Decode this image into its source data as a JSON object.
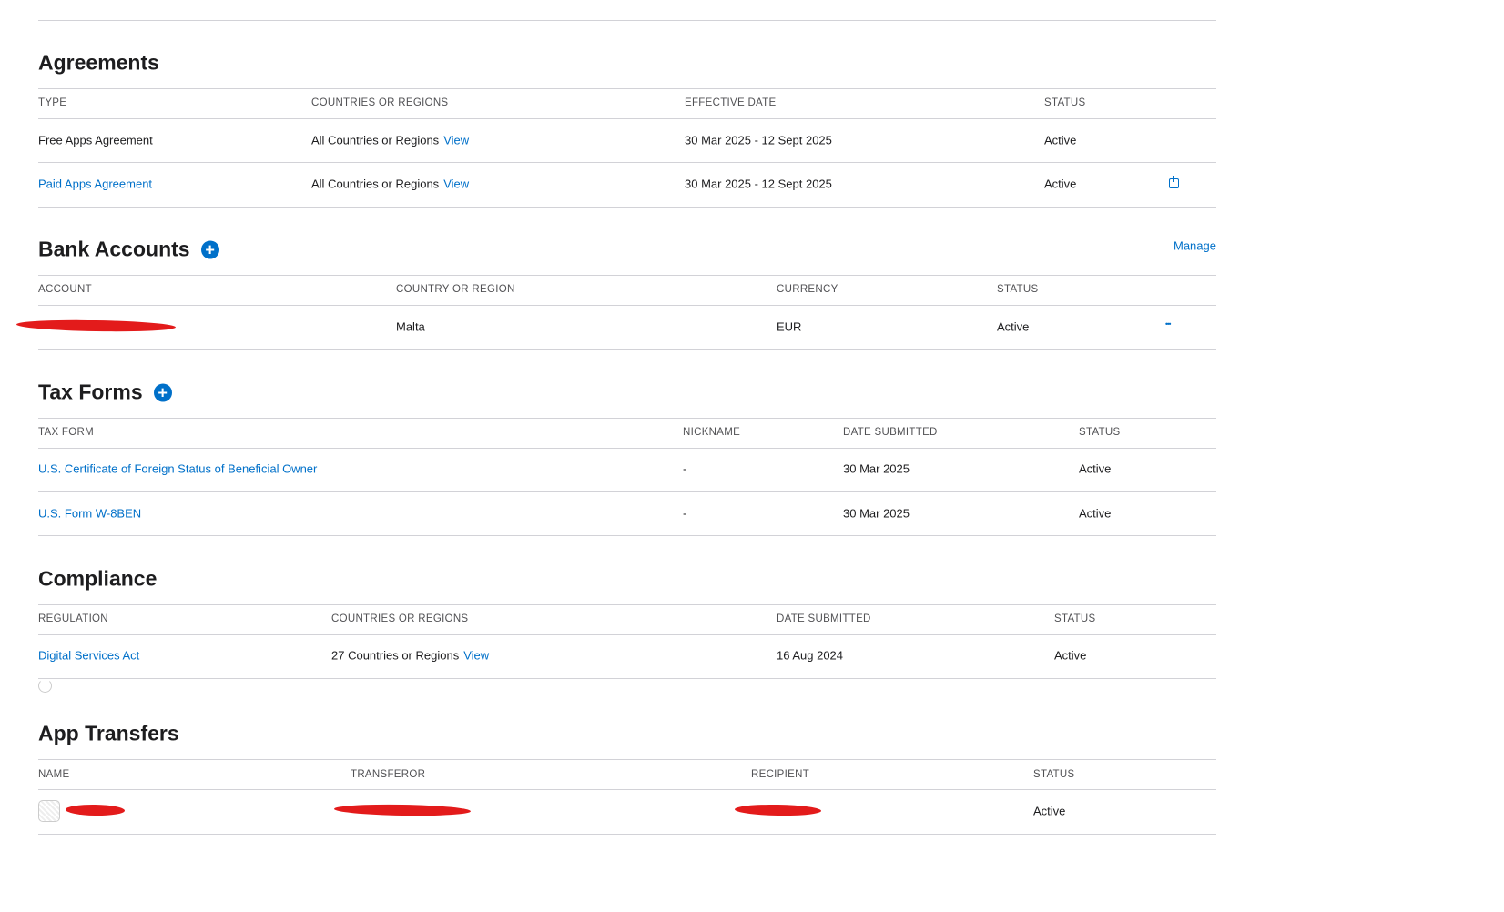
{
  "sections": [
    {
      "id": "agreements",
      "title": "Agreements",
      "add": false,
      "headers": [
        "TYPE",
        "COUNTRIES OR REGIONS",
        "EFFECTIVE DATE",
        "STATUS"
      ],
      "rows": [
        [
          {
            "t": "Free Apps Agreement"
          },
          {
            "t": "All Countries or Regions",
            "link": "View"
          },
          {
            "t": "30 Mar 2025 - 12 Sept 2025"
          },
          {
            "t": "Active"
          }
        ],
        [
          {
            "t": "Paid Apps Agreement",
            "isLink": true
          },
          {
            "t": "All Countries or Regions",
            "link": "View"
          },
          {
            "t": "30 Mar 2025 - 12 Sept 2025"
          },
          {
            "t": "Active"
          }
        ]
      ]
    },
    {
      "id": "bank-accounts",
      "title": "Bank Accounts",
      "add": true,
      "action": "Manage",
      "headers": [
        "ACCOUNT",
        "COUNTRY OR REGION",
        "CURRENCY",
        "STATUS"
      ],
      "rows": [
        [
          {
            "t": "",
            "redacted": true
          },
          {
            "t": "Malta"
          },
          {
            "t": "EUR"
          },
          {
            "t": "Active"
          }
        ]
      ]
    },
    {
      "id": "tax-forms",
      "title": "Tax Forms",
      "add": true,
      "headers": [
        "TAX FORM",
        "NICKNAME",
        "DATE SUBMITTED",
        "STATUS"
      ],
      "rows": [
        [
          {
            "t": "U.S. Certificate of Foreign Status of Beneficial Owner",
            "isLink": true
          },
          {
            "t": "-"
          },
          {
            "t": "30 Mar 2025"
          },
          {
            "t": "Active"
          }
        ],
        [
          {
            "t": "U.S. Form W-8BEN",
            "isLink": true
          },
          {
            "t": "-"
          },
          {
            "t": "30 Mar 2025"
          },
          {
            "t": "Active"
          }
        ]
      ]
    },
    {
      "id": "compliance",
      "title": "Compliance",
      "add": false,
      "headers": [
        "REGULATION",
        "COUNTRIES OR REGIONS",
        "DATE SUBMITTED",
        "STATUS"
      ],
      "rows": [
        [
          {
            "t": "Digital Services Act",
            "isLink": true
          },
          {
            "t": "27 Countries or Regions",
            "link": "View"
          },
          {
            "t": "16 Aug 2024"
          },
          {
            "t": "Active"
          }
        ]
      ]
    },
    {
      "id": "app-transfers",
      "title": "App Transfers",
      "add": false,
      "headers": [
        "NAME",
        "TRANSFEROR",
        "RECIPIENT",
        "STATUS"
      ],
      "rows": [
        [
          {
            "t": "",
            "redacted": true,
            "appIcon": true
          },
          {
            "t": "",
            "redacted": true
          },
          {
            "t": "",
            "redacted": true
          },
          {
            "t": "Active"
          }
        ]
      ]
    }
  ],
  "colors": {
    "link": "#0070c9",
    "redaction": "#e31b1b"
  }
}
